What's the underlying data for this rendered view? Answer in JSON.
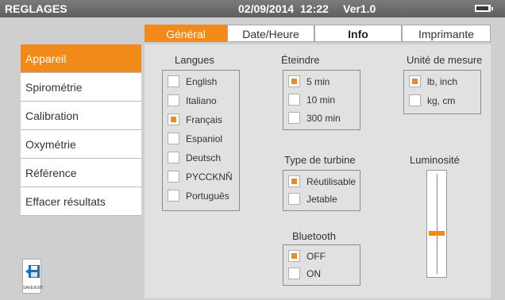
{
  "header": {
    "title": "REGLAGES",
    "date": "02/09/2014",
    "time": "12:22",
    "version": "Ver1.0"
  },
  "tabs": [
    {
      "label": "Général",
      "active": true
    },
    {
      "label": "Date/Heure",
      "active": false
    },
    {
      "label": "Info",
      "active": false
    },
    {
      "label": "Imprimante",
      "active": false
    }
  ],
  "menu": {
    "items": [
      {
        "label": "Appareil",
        "active": true
      },
      {
        "label": "Spirométrie",
        "active": false
      },
      {
        "label": "Calibration",
        "active": false
      },
      {
        "label": "Oxymétrie",
        "active": false
      },
      {
        "label": "Référence",
        "active": false
      },
      {
        "label": "Effacer résultats",
        "active": false
      }
    ]
  },
  "languages": {
    "title": "Langues",
    "options": [
      {
        "label": "English",
        "checked": false
      },
      {
        "label": "Italiano",
        "checked": false
      },
      {
        "label": "Français",
        "checked": true
      },
      {
        "label": "Espaniol",
        "checked": false
      },
      {
        "label": "Deutsch",
        "checked": false
      },
      {
        "label": "PYCCKNŇ",
        "checked": false
      },
      {
        "label": "Português",
        "checked": false
      }
    ]
  },
  "shutdown": {
    "title": "Éteindre",
    "options": [
      {
        "label": "5 min",
        "checked": true
      },
      {
        "label": "10 min",
        "checked": false
      },
      {
        "label": "300 min",
        "checked": false
      }
    ]
  },
  "units": {
    "title": "Unité de mesure",
    "options": [
      {
        "label": "lb, inch",
        "checked": true
      },
      {
        "label": "kg, cm",
        "checked": false
      }
    ]
  },
  "turbine": {
    "title": "Type de turbine",
    "options": [
      {
        "label": "Réutilisable",
        "checked": true
      },
      {
        "label": "Jetable",
        "checked": false
      }
    ]
  },
  "bluetooth": {
    "title": "Bluetooth",
    "options": [
      {
        "label": "OFF",
        "checked": true
      },
      {
        "label": "ON",
        "checked": false
      }
    ]
  },
  "brightness": {
    "title": "Luminosité",
    "level_fraction": 0.4
  },
  "save_exit": {
    "label": "SAVE/EXIT"
  },
  "colors": {
    "accent": "#f28a1a",
    "header_bg": "#6b6b6b",
    "panel_bg": "#e1e1e1"
  }
}
